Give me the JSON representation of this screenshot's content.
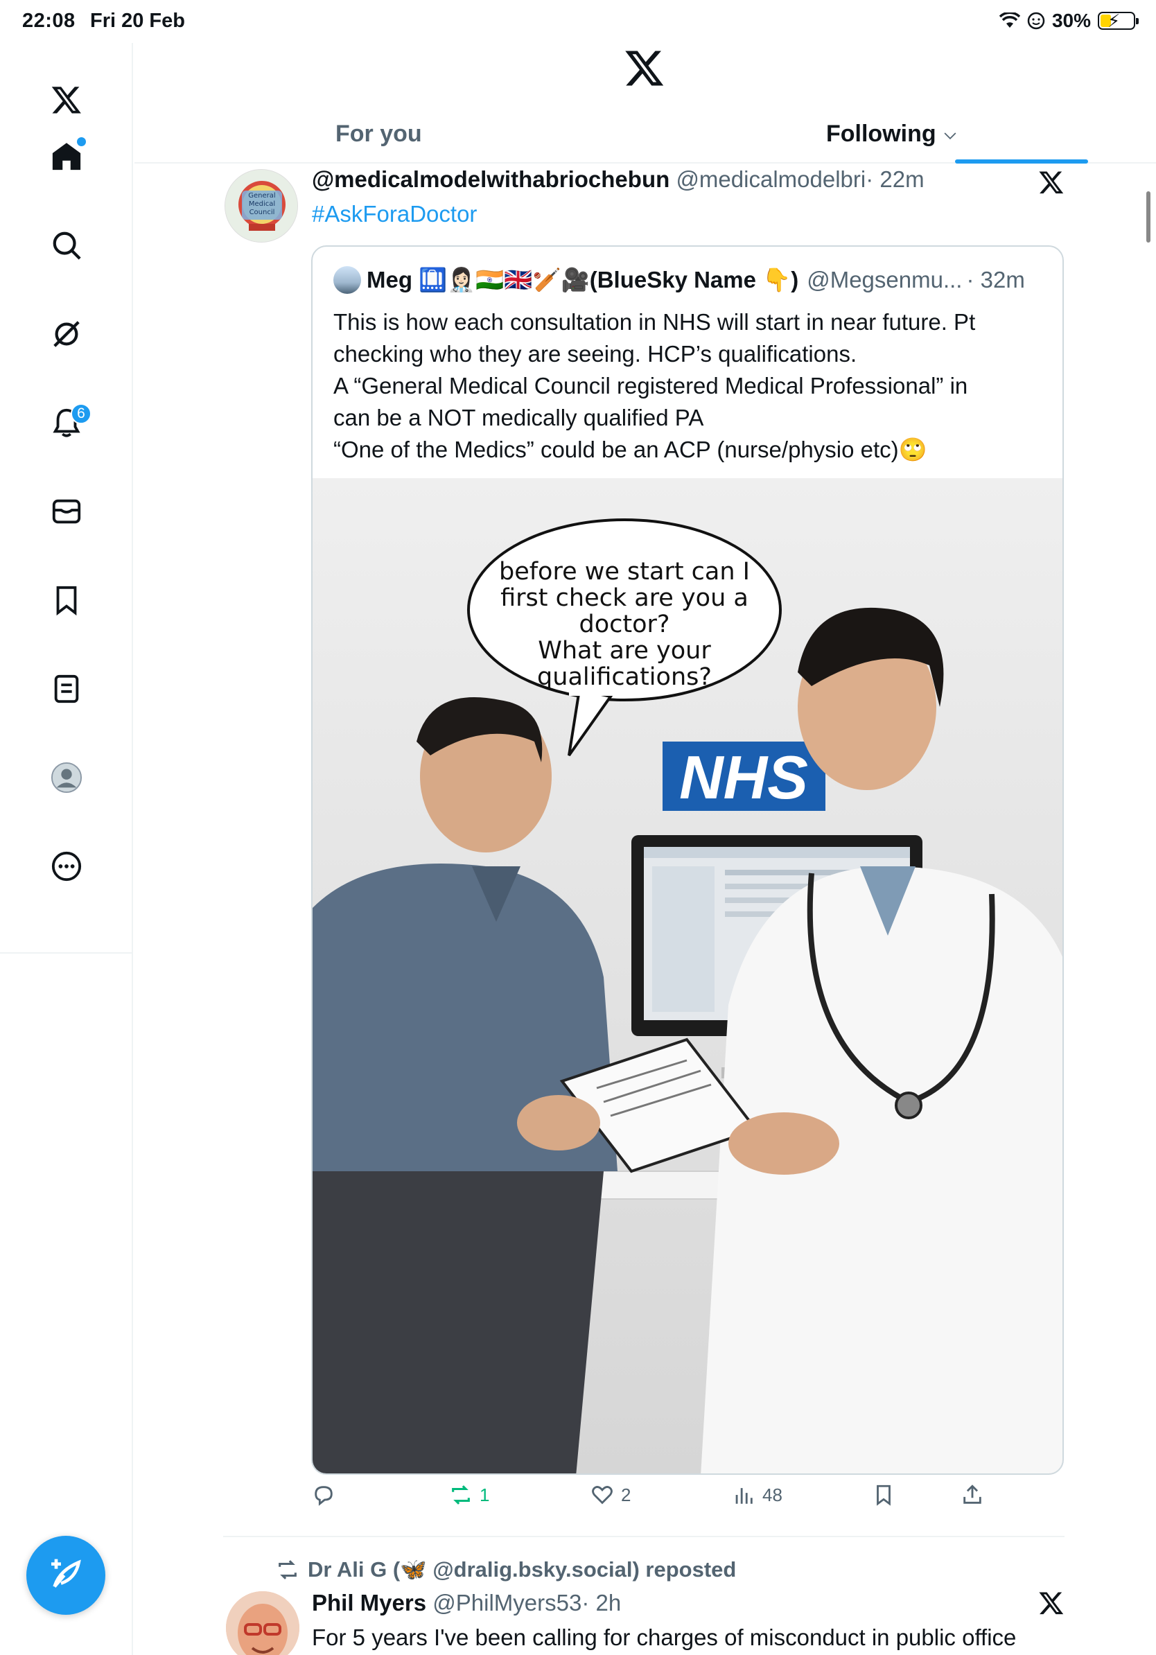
{
  "status_bar": {
    "time": "22:08",
    "date": "Fri 20 Feb",
    "battery": "30%",
    "icons": [
      "wifi-icon",
      "focus-icon",
      "battery-charging-icon"
    ]
  },
  "sidebar": {
    "items": [
      {
        "name": "x-logo-icon"
      },
      {
        "name": "home-icon",
        "has_dot": true
      },
      {
        "name": "search-icon"
      },
      {
        "name": "grok-icon"
      },
      {
        "name": "notifications-icon",
        "badge": "6"
      },
      {
        "name": "messages-icon"
      },
      {
        "name": "bookmarks-icon"
      },
      {
        "name": "lists-icon"
      },
      {
        "name": "profile-icon"
      },
      {
        "name": "more-icon"
      }
    ],
    "compose_icon": "compose-feather-icon"
  },
  "header": {
    "logo": "x-logo-icon",
    "tabs": [
      {
        "label": "For you",
        "active": false
      },
      {
        "label": "Following",
        "active": true
      }
    ]
  },
  "tweet1": {
    "name": "@medicalmodelwithabriochebun",
    "handle": "@medicalmodelbri",
    "time": "· 22m",
    "text": "#AskForaDoctor",
    "avatar_text": [
      "General",
      "Medical",
      "Council"
    ],
    "quote": {
      "name": "Meg 🛄👩🏻‍⚕️🇮🇳🇬🇧🏏🎥(BlueSky Name 👇)",
      "handle": "@Megsenmu...",
      "time": "· 32m",
      "lines": [
        "This is how each consultation in NHS will start in near future. Pt",
        "checking who they are seeing. HCP’s qualifications.",
        "A “General Medical Council registered Medical Professional” in",
        "can be a NOT medically qualified PA",
        "“One of the Medics” could be an ACP (nurse/physio etc)🙄"
      ],
      "image": {
        "speech_bubble": [
          "before we start can I",
          "first check are you a",
          "doctor?",
          "What are your",
          "qualifications?"
        ],
        "logo_text": "NHS"
      }
    },
    "actions": {
      "reply": "",
      "repost": "1",
      "like": "2",
      "views": "48"
    },
    "accent_colors": {
      "repost": "#00ba7c",
      "link": "#1d9bf0"
    }
  },
  "tweet2": {
    "repost_by": "Dr Ali G (🦋 @dralig.bsky.social) reposted",
    "name": "Phil Myers",
    "handle": "@PhilMyers53",
    "time": "· 2h",
    "text": "For 5 years I've been calling for charges of misconduct in public office"
  }
}
